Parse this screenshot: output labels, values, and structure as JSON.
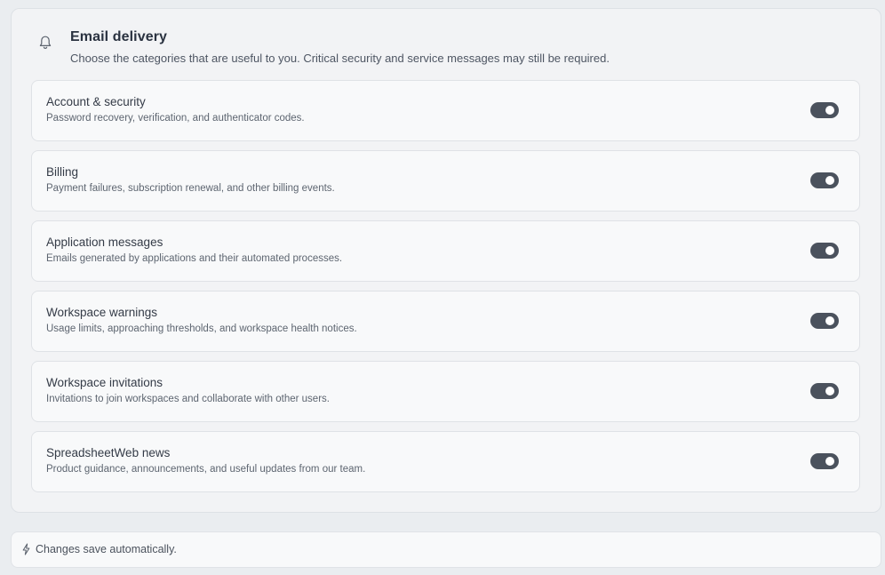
{
  "header": {
    "icon": "bell-icon",
    "title": "Email delivery",
    "subtitle": "Choose the categories that are useful to you. Critical security and service messages may still be required."
  },
  "categories": [
    {
      "label": "Account & security",
      "description": "Password recovery, verification, and authenticator codes.",
      "enabled": true
    },
    {
      "label": "Billing",
      "description": "Payment failures, subscription renewal, and other billing events.",
      "enabled": true
    },
    {
      "label": "Application messages",
      "description": "Emails generated by applications and their automated processes.",
      "enabled": true
    },
    {
      "label": "Workspace warnings",
      "description": "Usage limits, approaching thresholds, and workspace health notices.",
      "enabled": true
    },
    {
      "label": "Workspace invitations",
      "description": "Invitations to join workspaces and collaborate with other users.",
      "enabled": true
    },
    {
      "label": "SpreadsheetWeb news",
      "description": "Product guidance, announcements, and useful updates from our team.",
      "enabled": true
    }
  ],
  "footer": {
    "icon": "lightning-icon",
    "text": "Changes save automatically."
  },
  "colors": {
    "toggle_on": "#4b525d",
    "panel_bg": "#f2f3f5",
    "row_bg": "#f8f9fa"
  }
}
